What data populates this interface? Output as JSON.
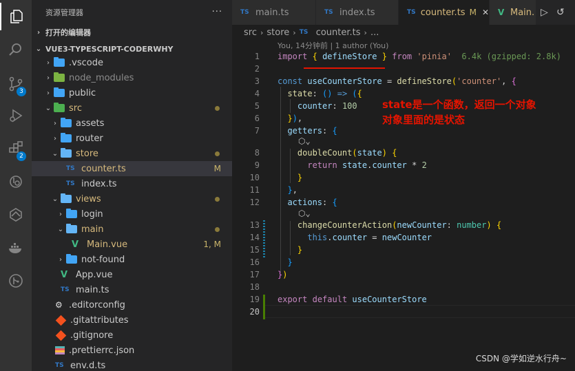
{
  "activity_bar": {
    "items": [
      {
        "icon": "explorer-icon"
      },
      {
        "icon": "search-icon"
      },
      {
        "icon": "source-control-icon",
        "badge": "3"
      },
      {
        "icon": "run-debug-icon"
      },
      {
        "icon": "extensions-icon",
        "badge": "2"
      },
      {
        "icon": "remote-explorer-icon"
      },
      {
        "icon": "gitlens-icon"
      },
      {
        "icon": "docker-icon"
      },
      {
        "icon": "git-graph-icon"
      }
    ]
  },
  "sidebar": {
    "title": "资源管理器",
    "more": "···",
    "open_editors": "打开的编辑器",
    "project": "VUE3-TYPESCRIPT-CODERWHY",
    "tree": [
      {
        "label": ".vscode"
      },
      {
        "label": "node_modules"
      },
      {
        "label": "public"
      },
      {
        "label": "src"
      },
      {
        "label": "assets"
      },
      {
        "label": "router"
      },
      {
        "label": "store"
      },
      {
        "label": "counter.ts",
        "status": "M"
      },
      {
        "label": "index.ts"
      },
      {
        "label": "views"
      },
      {
        "label": "login"
      },
      {
        "label": "main"
      },
      {
        "label": "Main.vue",
        "status": "1, M"
      },
      {
        "label": "not-found"
      },
      {
        "label": "App.vue"
      },
      {
        "label": "main.ts"
      },
      {
        "label": ".editorconfig"
      },
      {
        "label": ".gitattributes"
      },
      {
        "label": ".gitignore"
      },
      {
        "label": ".prettierrc.json"
      },
      {
        "label": "env.d.ts"
      }
    ]
  },
  "tabs": [
    {
      "prefix": "TS",
      "label": "main.ts"
    },
    {
      "prefix": "TS",
      "label": "index.ts"
    },
    {
      "prefix": "TS",
      "label": "counter.ts",
      "status": "M"
    },
    {
      "prefix": "V",
      "label": "Main."
    }
  ],
  "breadcrumb": [
    "src",
    "store",
    "counter.ts",
    "..."
  ],
  "editor": {
    "blame": "You, 14分钟前 | 1 author (You)",
    "import_size": "6.4k (gzipped: 2.8k)",
    "line_numbers": [
      "1",
      "2",
      "3",
      "4",
      "5",
      "6",
      "7",
      "8",
      "9",
      "10",
      "11",
      "12",
      "13",
      "14",
      "15",
      "16",
      "17",
      "18",
      "19",
      "20"
    ],
    "annotation": [
      "state是一个函数，返回一个对象",
      "对象里面的是状态"
    ]
  },
  "watermark": "CSDN @学如逆水行舟~",
  "colors": {
    "accent": "#007acc",
    "annotation": "#e51400",
    "modified": "#c9b46a"
  }
}
